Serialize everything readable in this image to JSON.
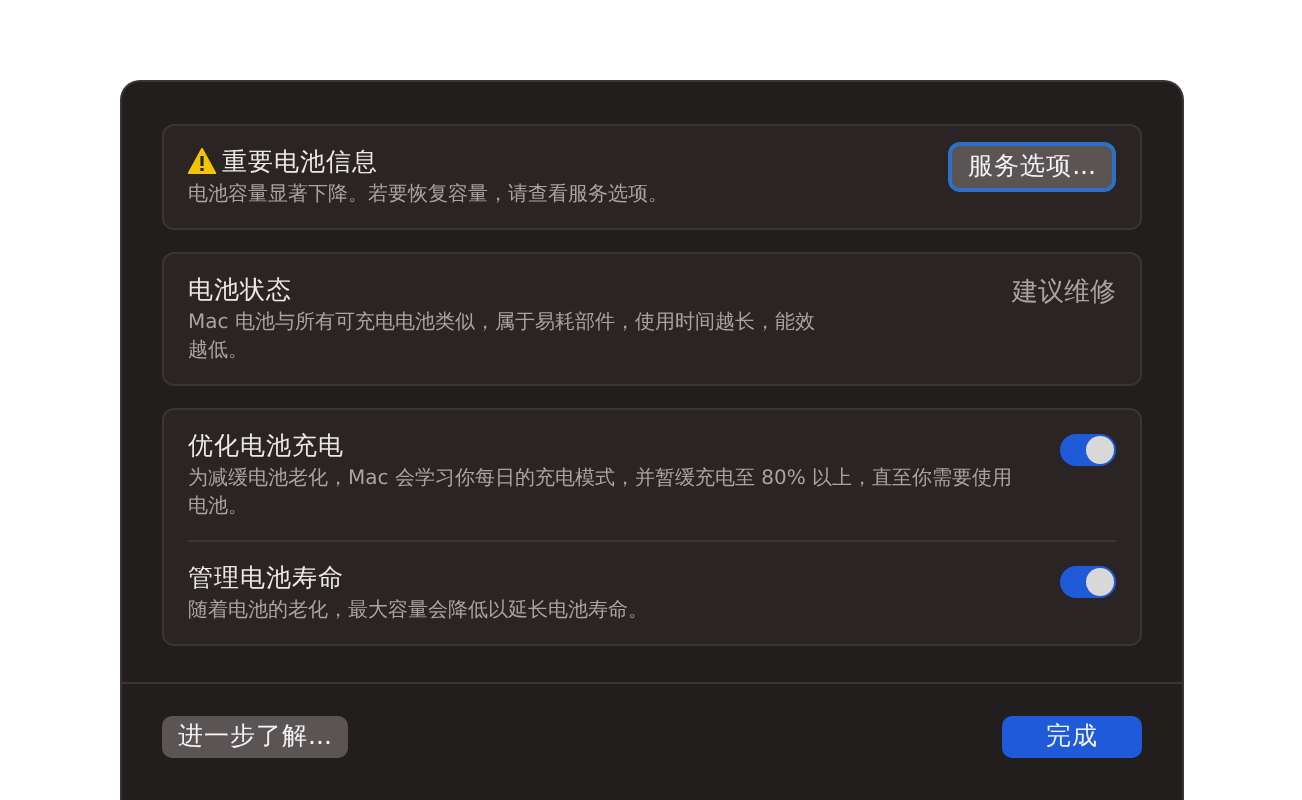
{
  "alert": {
    "title": "重要电池信息",
    "description": "电池容量显著下降。若要恢复容量，请查看服务选项。",
    "button": "服务选项..."
  },
  "status": {
    "title": "电池状态",
    "description": "Mac 电池与所有可充电电池类似，属于易耗部件，使用时间越长，能效越低。",
    "value": "建议维修"
  },
  "settings": [
    {
      "title": "优化电池充电",
      "description": "为减缓电池老化，Mac 会学习你每日的充电模式，并暂缓充电至 80% 以上，直至你需要使用电池。",
      "on": true
    },
    {
      "title": "管理电池寿命",
      "description": "随着电池的老化，最大容量会降低以延长电池寿命。",
      "on": true
    }
  ],
  "footer": {
    "learn_more": "进一步了解...",
    "done": "完成"
  }
}
